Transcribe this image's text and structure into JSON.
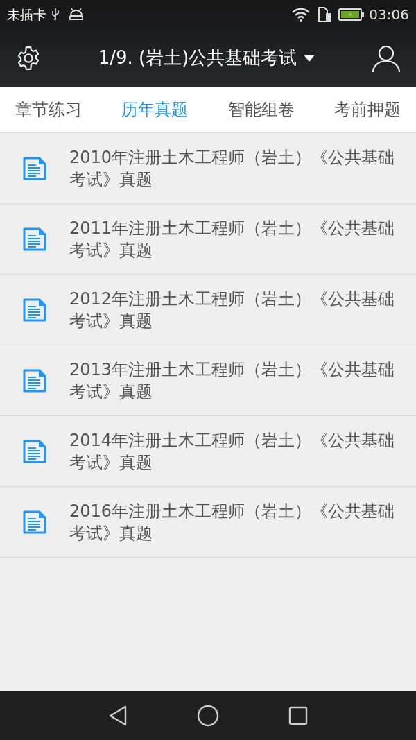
{
  "status_bar": {
    "carrier": "未插卡",
    "time": "03:06"
  },
  "header": {
    "title": "1/9. (岩土)公共基础考试"
  },
  "tabs": [
    {
      "label": "章节练习",
      "selected": false
    },
    {
      "label": "历年真题",
      "selected": true
    },
    {
      "label": "智能组卷",
      "selected": false
    },
    {
      "label": "考前押题",
      "selected": false
    }
  ],
  "items": [
    {
      "title": "2010年注册土木工程师（岩土）《公共基础考试》真题"
    },
    {
      "title": "2011年注册土木工程师（岩土）《公共基础考试》真题"
    },
    {
      "title": "2012年注册土木工程师（岩土）《公共基础考试》真题"
    },
    {
      "title": "2013年注册土木工程师（岩土）《公共基础考试》真题"
    },
    {
      "title": "2014年注册土木工程师（岩土）《公共基础考试》真题"
    },
    {
      "title": "2016年注册土木工程师（岩土）《公共基础考试》真题"
    }
  ]
}
